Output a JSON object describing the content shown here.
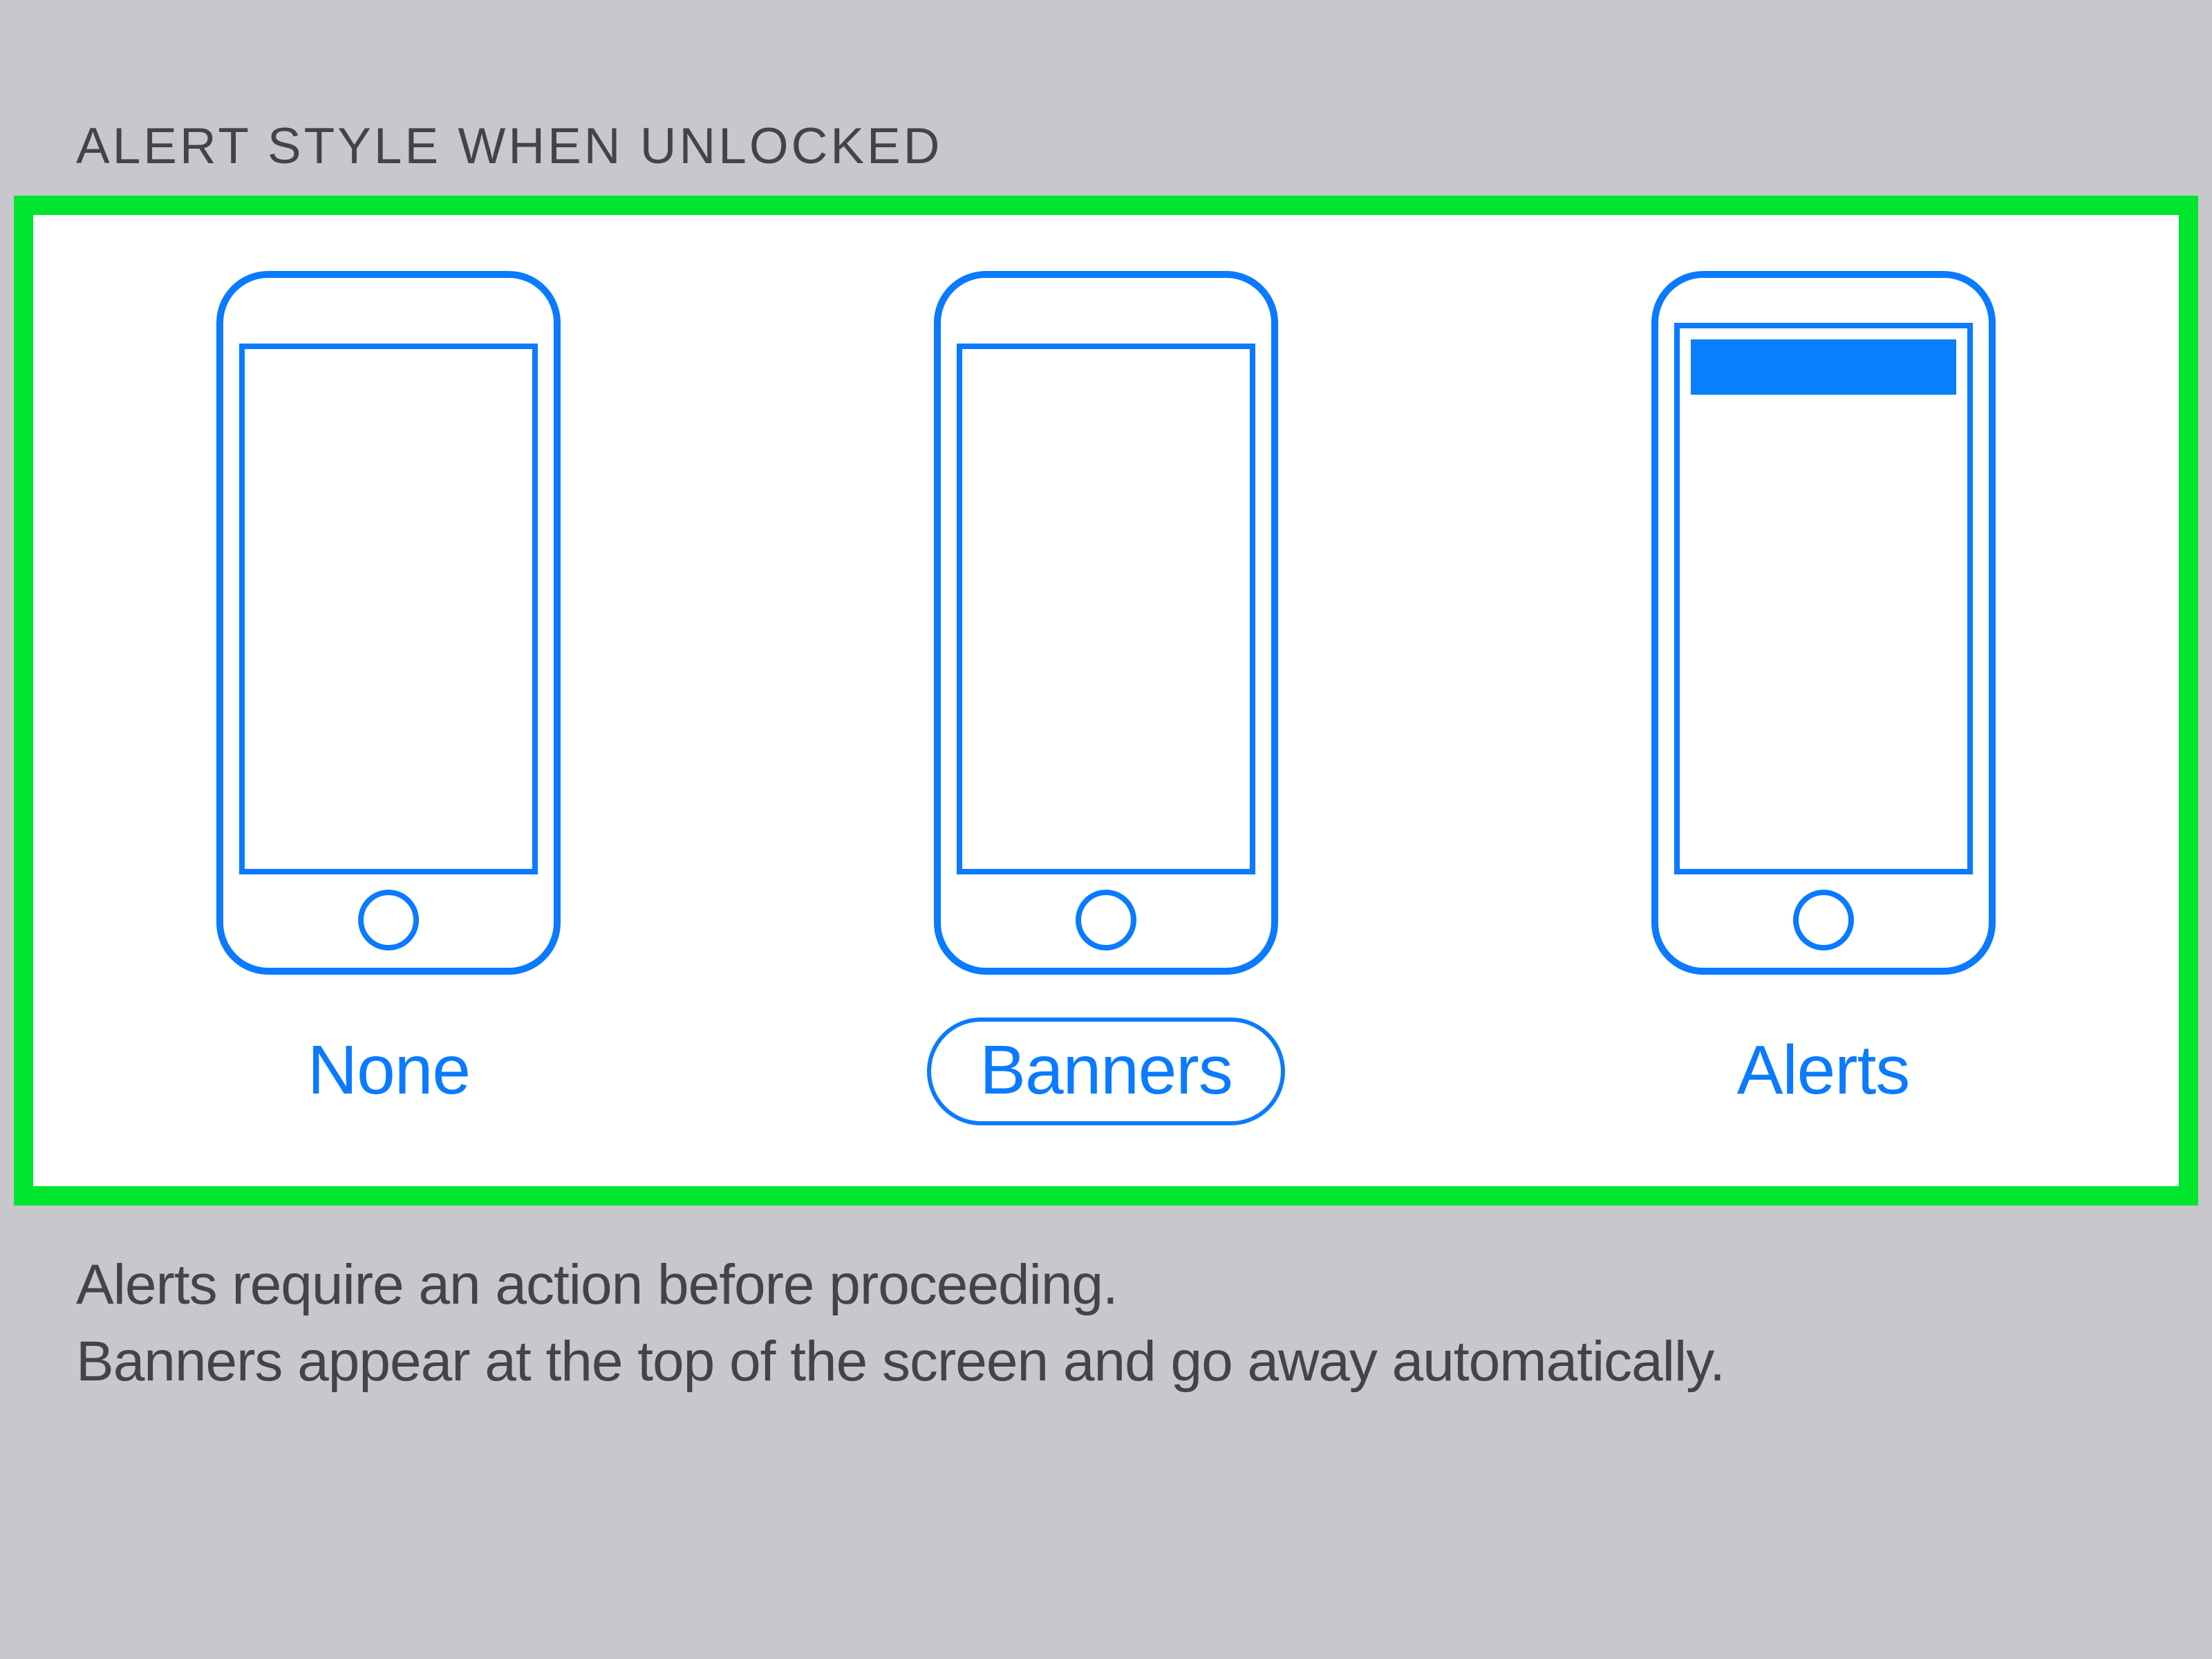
{
  "section": {
    "header": "ALERT STYLE WHEN UNLOCKED"
  },
  "alert_styles": {
    "options": [
      {
        "label": "None",
        "selected": false,
        "banner": null
      },
      {
        "label": "Banners",
        "selected": true,
        "banner": null
      },
      {
        "label": "Alerts",
        "selected": false,
        "banner": "filled"
      }
    ]
  },
  "footer": {
    "line1": "Alerts require an action before proceeding.",
    "line2": "Banners appear at the top of the screen and go away automatically."
  },
  "colors": {
    "ios_blue": "#0a7aff",
    "highlight_green": "#00e62e",
    "background_gray": "#c7c7cc",
    "text_gray": "#444446",
    "solid_blue": "#087ffc"
  }
}
